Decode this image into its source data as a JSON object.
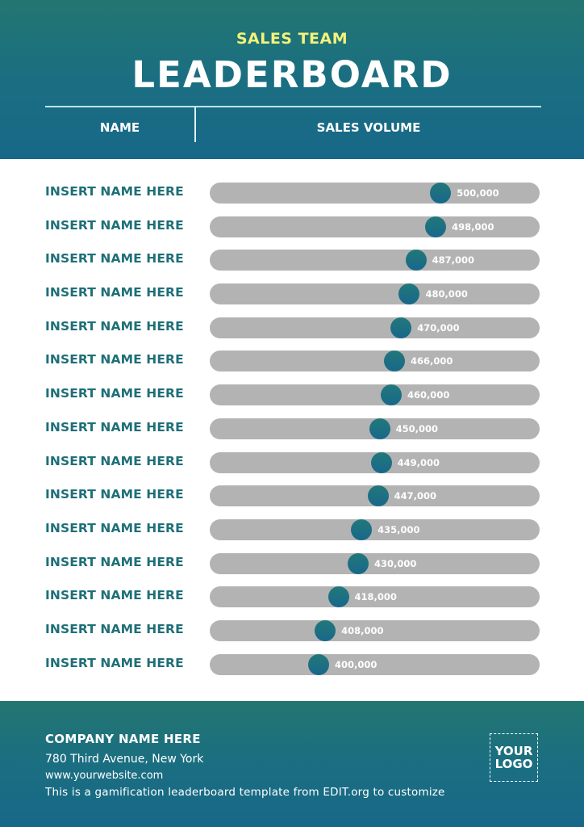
{
  "header": {
    "subtitle": "SALES TEAM",
    "title": "LEADERBOARD",
    "columns": {
      "name": "NAME",
      "sales": "SALES VOLUME"
    }
  },
  "colors": {
    "header_bg": "#1b6f80",
    "subtitle": "#f4f27a",
    "name_text": "#1f6f78",
    "track": "#b3b3b3",
    "dot": "#1b6f80"
  },
  "chart_data": {
    "type": "bar",
    "title": "SALES TEAM LEADERBOARD",
    "xlabel": "SALES VOLUME",
    "ylabel": "NAME",
    "scale": {
      "min": 0,
      "max": 100
    },
    "categories": [
      "INSERT NAME HERE",
      "INSERT NAME HERE",
      "INSERT NAME HERE",
      "INSERT NAME HERE",
      "INSERT NAME HERE",
      "INSERT NAME HERE",
      "INSERT NAME HERE",
      "INSERT NAME HERE",
      "INSERT NAME HERE",
      "INSERT NAME HERE",
      "INSERT NAME HERE",
      "INSERT NAME HERE",
      "INSERT NAME HERE",
      "INSERT NAME HERE",
      "INSERT NAME HERE"
    ],
    "values": [
      500000,
      498000,
      487000,
      480000,
      470000,
      466000,
      460000,
      450000,
      449000,
      447000,
      435000,
      430000,
      418000,
      408000,
      400000
    ],
    "labels": [
      "500,000",
      "498,000",
      "487,000",
      "480,000",
      "470,000",
      "466,000",
      "460,000",
      "450,000",
      "449,000",
      "447,000",
      "435,000",
      "430,000",
      "418,000",
      "408,000",
      "400,000"
    ],
    "marker_percent": [
      70,
      68.5,
      62.5,
      60.5,
      58,
      56,
      55,
      51.5,
      52,
      51,
      46,
      45,
      39,
      35,
      33
    ]
  },
  "footer": {
    "company": "COMPANY NAME HERE",
    "address": "780 Third Avenue, New York",
    "website": "www.yourwebsite.com",
    "note": "This is a gamification leaderboard template from EDIT.org to customize",
    "logo_line1": "YOUR",
    "logo_line2": "LOGO"
  }
}
